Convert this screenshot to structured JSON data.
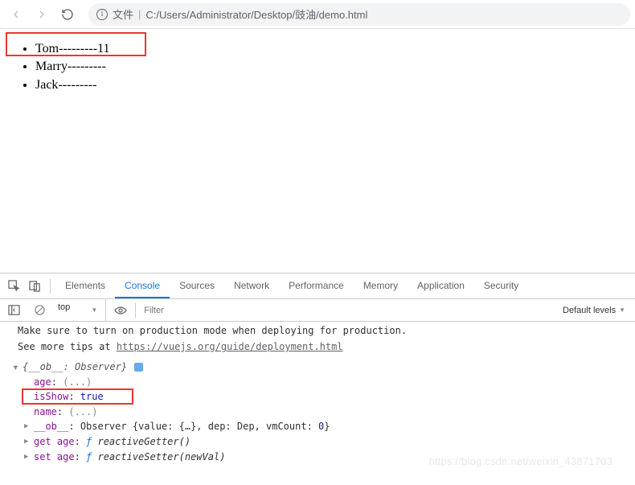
{
  "toolbar": {
    "url_label": "文件",
    "url_path": "C:/Users/Administrator/Desktop/豉油/demo.html"
  },
  "page": {
    "items": [
      {
        "name": "Tom",
        "suffix": "---------11"
      },
      {
        "name": "Marry",
        "suffix": "---------"
      },
      {
        "name": "Jack",
        "suffix": "---------"
      }
    ]
  },
  "devtools": {
    "tabs": [
      "Elements",
      "Console",
      "Sources",
      "Network",
      "Performance",
      "Memory",
      "Application",
      "Security"
    ],
    "active_tab": "Console",
    "context": "top",
    "filter_placeholder": "Filter",
    "levels_label": "Default levels",
    "warn_line1": "Make sure to turn on production mode when deploying for production.",
    "warn_line2_prefix": "See more tips at ",
    "warn_line2_link": "https://vuejs.org/guide/deployment.html",
    "object_header": "{__ob__: Observer}",
    "props": {
      "age_key": "age",
      "age_val": "(...)",
      "isShow_key": "isShow",
      "isShow_val": "true",
      "name_key": "name",
      "name_val": "(...)",
      "ob_key": "__ob__",
      "ob_val_prefix": "Observer {value: {…}, dep: Dep, vmCount: ",
      "ob_vmcount": "0",
      "ob_val_suffix": "}",
      "get_age_key": "get age",
      "get_age_val": "reactiveGetter()",
      "set_age_key": "set age",
      "set_age_val": "reactiveSetter(newVal)"
    }
  },
  "watermark": "https://blog.csdn.net/weixin_43871703"
}
